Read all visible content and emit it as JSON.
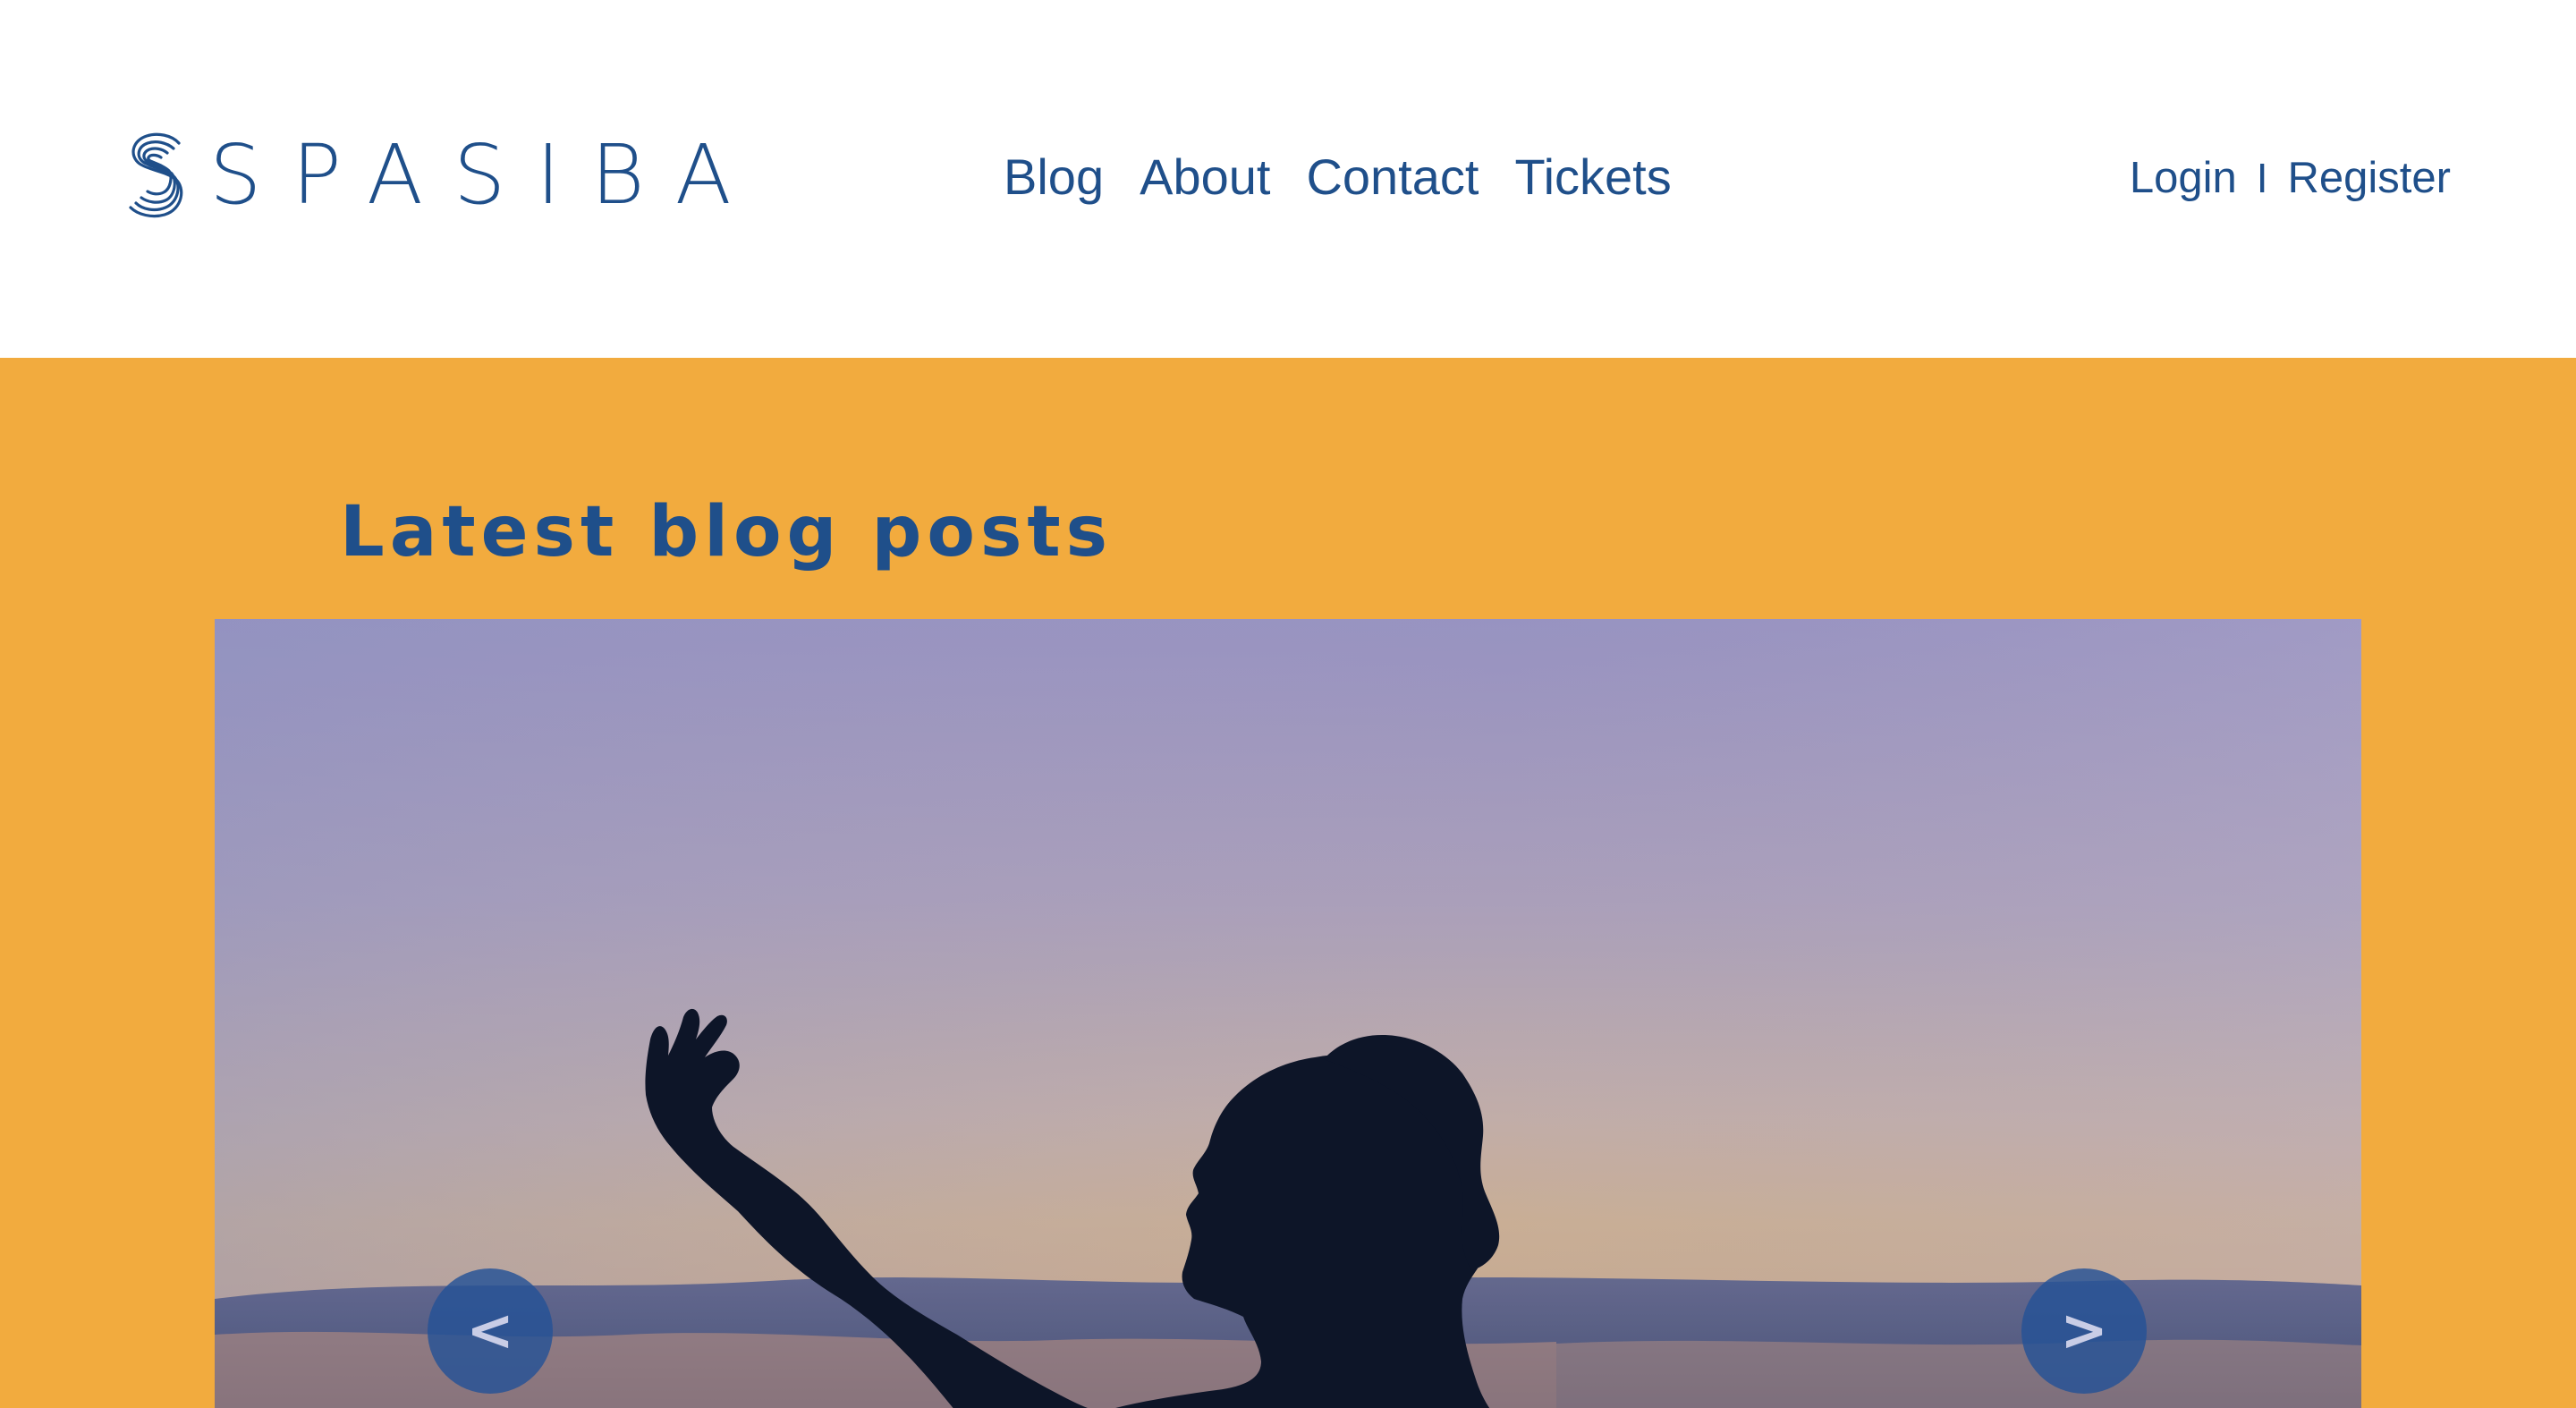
{
  "header": {
    "logo_text": "SPASIBA",
    "nav": {
      "blog": "Blog",
      "about": "About",
      "contact": "Contact",
      "tickets": "Tickets"
    },
    "auth": {
      "login": "Login",
      "separator": "I",
      "register": "Register"
    }
  },
  "blog_section": {
    "title": "Latest blog posts",
    "carousel": {
      "prev_label": "<",
      "next_label": ">"
    }
  },
  "colors": {
    "brand_blue": "#1f4f8a",
    "section_background": "#f2ab3e",
    "button_background": "#245296",
    "button_glyph": "#c9cde6"
  },
  "icons": {
    "logo_mark": "concentric-s-icon"
  }
}
